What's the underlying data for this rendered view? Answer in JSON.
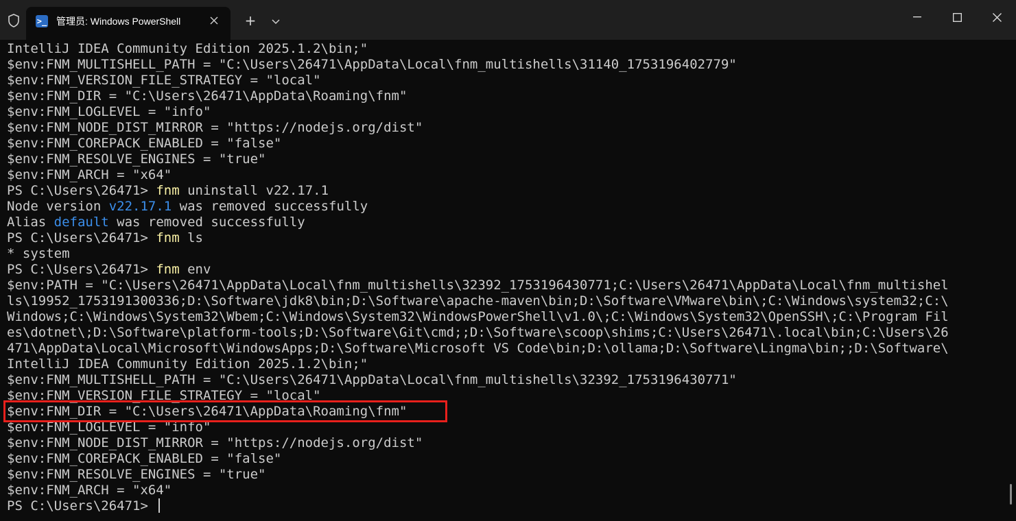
{
  "window": {
    "tab_title": "管理员: Windows PowerShell",
    "tab_icon_glyph": ">_",
    "new_tab": "+",
    "colors": {
      "titlebar": "#1f1f1f",
      "terminal_bg": "#0c0c0c",
      "text": "#cccccc",
      "command": "#f9f1a5",
      "version": "#3b8eea",
      "highlight_box": "#e8201c"
    }
  },
  "terminal": {
    "lines": [
      {
        "t": "IntelliJ IDEA Community Edition 2025.1.2\\bin;\""
      },
      {
        "t": "$env:FNM_MULTISHELL_PATH = \"C:\\Users\\26471\\AppData\\Local\\fnm_multishells\\31140_1753196402779\""
      },
      {
        "t": "$env:FNM_VERSION_FILE_STRATEGY = \"local\""
      },
      {
        "t": "$env:FNM_DIR = \"C:\\Users\\26471\\AppData\\Roaming\\fnm\""
      },
      {
        "t": "$env:FNM_LOGLEVEL = \"info\""
      },
      {
        "t": "$env:FNM_NODE_DIST_MIRROR = \"https://nodejs.org/dist\""
      },
      {
        "t": "$env:FNM_COREPACK_ENABLED = \"false\""
      },
      {
        "t": "$env:FNM_RESOLVE_ENGINES = \"true\""
      },
      {
        "t": "$env:FNM_ARCH = \"x64\""
      },
      {
        "prompt": "PS C:\\Users\\26471> ",
        "cmd": "fnm",
        "args": " uninstall v22.17.1"
      },
      {
        "pre": "Node version ",
        "hl": "v22.17.1",
        "post": " was removed successfully"
      },
      {
        "pre": "Alias ",
        "hl": "default",
        "post": " was removed successfully"
      },
      {
        "prompt": "PS C:\\Users\\26471> ",
        "cmd": "fnm",
        "args": " ls"
      },
      {
        "t": "* system"
      },
      {
        "prompt": "PS C:\\Users\\26471> ",
        "cmd": "fnm",
        "args": " env"
      },
      {
        "t": "$env:PATH = \"C:\\Users\\26471\\AppData\\Local\\fnm_multishells\\32392_1753196430771;C:\\Users\\26471\\AppData\\Local\\fnm_multishel"
      },
      {
        "t": "ls\\19952_1753191300336;D:\\Software\\jdk8\\bin;D:\\Software\\apache-maven\\bin;D:\\Software\\VMware\\bin\\;C:\\Windows\\system32;C:\\"
      },
      {
        "t": "Windows;C:\\Windows\\System32\\Wbem;C:\\Windows\\System32\\WindowsPowerShell\\v1.0\\;C:\\Windows\\System32\\OpenSSH\\;C:\\Program Fil"
      },
      {
        "t": "es\\dotnet\\;D:\\Software\\platform-tools;D:\\Software\\Git\\cmd;;D:\\Software\\scoop\\shims;C:\\Users\\26471\\.local\\bin;C:\\Users\\26"
      },
      {
        "t": "471\\AppData\\Local\\Microsoft\\WindowsApps;D:\\Software\\Microsoft VS Code\\bin;D:\\ollama;D:\\Software\\Lingma\\bin;;D:\\Software\\"
      },
      {
        "t": "IntelliJ IDEA Community Edition 2025.1.2\\bin;\""
      },
      {
        "t": "$env:FNM_MULTISHELL_PATH = \"C:\\Users\\26471\\AppData\\Local\\fnm_multishells\\32392_1753196430771\""
      },
      {
        "t": "$env:FNM_VERSION_FILE_STRATEGY = \"local\""
      },
      {
        "t": "$env:FNM_DIR = \"C:\\Users\\26471\\AppData\\Roaming\\fnm\""
      },
      {
        "t": "$env:FNM_LOGLEVEL = \"info\""
      },
      {
        "t": "$env:FNM_NODE_DIST_MIRROR = \"https://nodejs.org/dist\""
      },
      {
        "t": "$env:FNM_COREPACK_ENABLED = \"false\""
      },
      {
        "t": "$env:FNM_RESOLVE_ENGINES = \"true\""
      },
      {
        "t": "$env:FNM_ARCH = \"x64\""
      },
      {
        "prompt": "PS C:\\Users\\26471> ",
        "cursor": true
      }
    ]
  }
}
